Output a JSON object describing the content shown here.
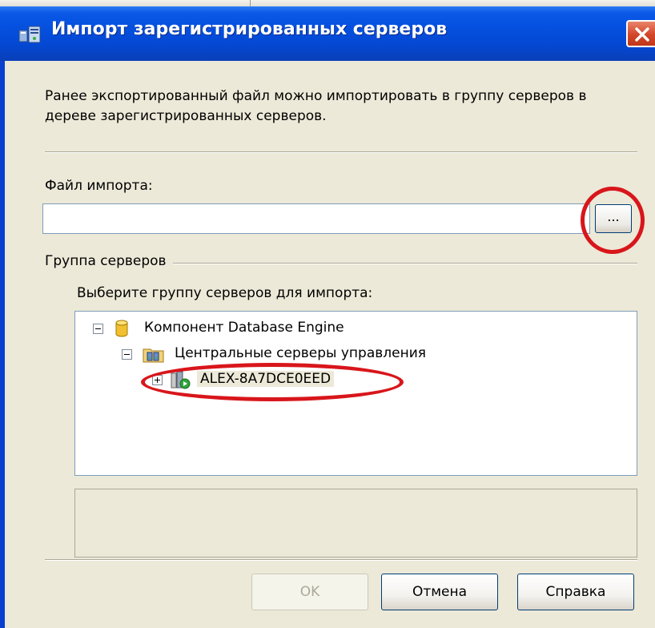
{
  "dialog": {
    "title": "Импорт зарегистрированных серверов",
    "description": "Ранее экспортированный файл можно импортировать в группу серверов в дереве зарегистрированных серверов.",
    "close_icon": "close-icon"
  },
  "file_import": {
    "label": "Файл импорта:",
    "value": "",
    "browse_label": "..."
  },
  "server_group": {
    "legend": "Группа серверов",
    "prompt": "Выберите группу серверов для импорта:",
    "tree": {
      "root": {
        "label": "Компонент Database Engine",
        "icon": "database-cylinder-icon",
        "expanded": true
      },
      "group": {
        "label": "Центральные серверы управления",
        "icon": "server-group-folder-icon",
        "expanded": true
      },
      "server": {
        "label": "ALEX-8A7DCE0EED",
        "icon": "server-running-icon",
        "expanded": false,
        "selected": true
      }
    }
  },
  "buttons": {
    "ok": "OK",
    "cancel": "Отмена",
    "help": "Справка"
  },
  "annotations": {
    "color": "#d8161b"
  }
}
